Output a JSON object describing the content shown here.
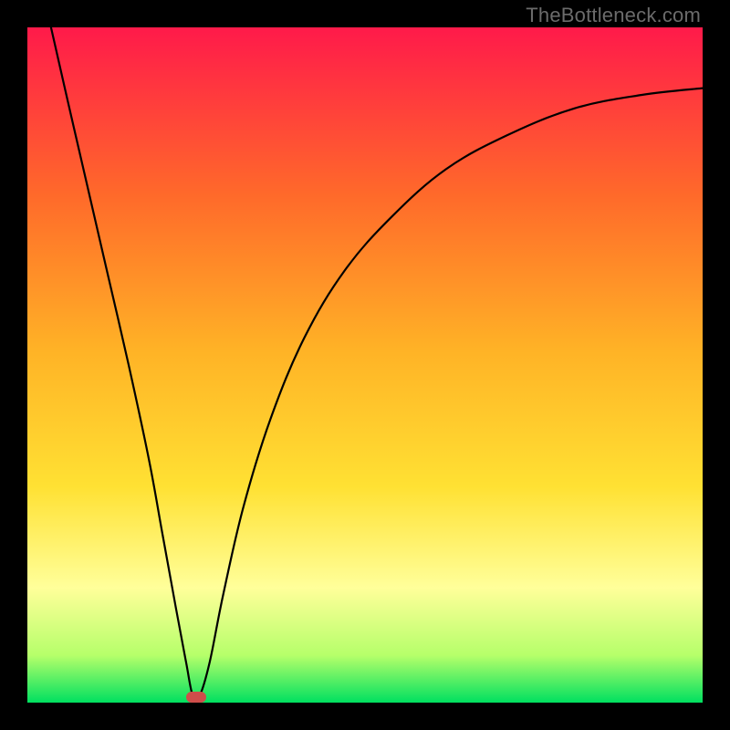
{
  "watermark": "TheBottleneck.com",
  "colors": {
    "top": "#ff1a4a",
    "upper_mid": "#ff6a2a",
    "mid": "#ffb326",
    "low_mid": "#ffe133",
    "pale_yellow": "#ffff9a",
    "near_bottom": "#b6ff6a",
    "bottom": "#00e060",
    "black": "#000000",
    "curve": "#000000",
    "marker": "#cf4d4a"
  },
  "chart_data": {
    "type": "line",
    "title": "",
    "xlabel": "",
    "ylabel": "",
    "xlim": [
      0,
      100
    ],
    "ylim": [
      0,
      100
    ],
    "grid": false,
    "legend": false,
    "annotations": [
      "TheBottleneck.com"
    ],
    "series": [
      {
        "name": "bottleneck-curve",
        "comment": "V-shaped bottleneck curve; values are percentages read from the gradient plot (approximate).",
        "points": [
          {
            "x": 3.5,
            "y": 100
          },
          {
            "x": 6,
            "y": 89
          },
          {
            "x": 9,
            "y": 76
          },
          {
            "x": 12,
            "y": 63
          },
          {
            "x": 15,
            "y": 50
          },
          {
            "x": 18,
            "y": 36
          },
          {
            "x": 20,
            "y": 25
          },
          {
            "x": 22,
            "y": 14
          },
          {
            "x": 23.5,
            "y": 6
          },
          {
            "x": 24.5,
            "y": 1
          },
          {
            "x": 25.5,
            "y": 1
          },
          {
            "x": 27,
            "y": 6
          },
          {
            "x": 29,
            "y": 16
          },
          {
            "x": 32,
            "y": 29
          },
          {
            "x": 36,
            "y": 42
          },
          {
            "x": 41,
            "y": 54
          },
          {
            "x": 47,
            "y": 64
          },
          {
            "x": 54,
            "y": 72
          },
          {
            "x": 62,
            "y": 79
          },
          {
            "x": 71,
            "y": 84
          },
          {
            "x": 81,
            "y": 88
          },
          {
            "x": 91,
            "y": 90
          },
          {
            "x": 100,
            "y": 91
          }
        ]
      }
    ],
    "marker": {
      "comment": "small rounded pill marker at curve minimum",
      "x": 25,
      "y": 0.8,
      "w_pct": 3.0,
      "h_pct": 1.6
    },
    "gradient_stops_pct": [
      {
        "offset": 0,
        "key": "top"
      },
      {
        "offset": 25,
        "key": "upper_mid"
      },
      {
        "offset": 48,
        "key": "mid"
      },
      {
        "offset": 68,
        "key": "low_mid"
      },
      {
        "offset": 83,
        "key": "pale_yellow"
      },
      {
        "offset": 93,
        "key": "near_bottom"
      },
      {
        "offset": 100,
        "key": "bottom"
      }
    ]
  }
}
